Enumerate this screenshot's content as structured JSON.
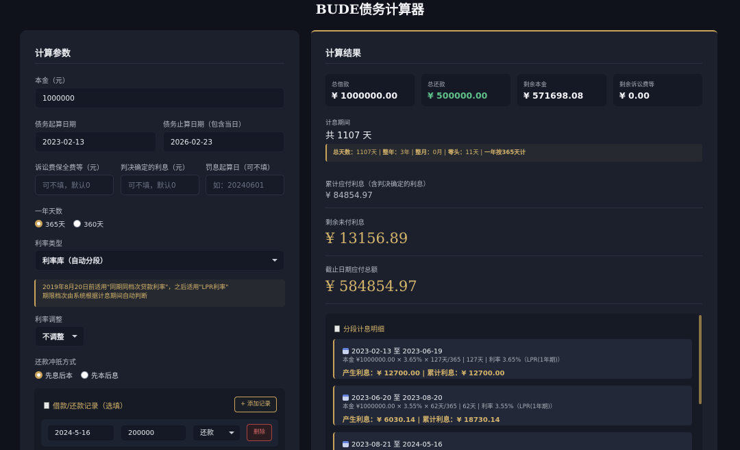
{
  "app": {
    "title": "BUDE债务计算器"
  },
  "params": {
    "title": "计算参数",
    "principal": {
      "label": "本金（元）",
      "value": "1000000"
    },
    "start_date": {
      "label": "债务起算日期",
      "value": "2023-02-13"
    },
    "end_date": {
      "label": "债务止算日期（包含当日）",
      "value": "2026-02-23"
    },
    "fees": {
      "label": "诉讼费保全费等（元）",
      "placeholder": "可不填，默认0"
    },
    "judged_interest": {
      "label": "判决确定的利息（元）",
      "placeholder": "可不填，默认0"
    },
    "penalty_date": {
      "label": "罚息起算日（可不填）",
      "placeholder": "如：20240601"
    },
    "days_per_year": {
      "label": "一年天数",
      "options": [
        "365天",
        "360天"
      ],
      "selected": "365天"
    },
    "rate_type": {
      "label": "利率类型",
      "value": "利率库（自动分段）"
    },
    "notice": {
      "line1": "2019年8月20日前适用\"同期同档次贷款利率\"，之后适用\"LPR利率\"",
      "line2": "期限档次由系统根据计息期间自动判断"
    },
    "rate_adjust": {
      "label": "利率调整",
      "value": "不调整"
    },
    "offset_method": {
      "label": "还款冲抵方式",
      "options": [
        "先息后本",
        "先本后息"
      ],
      "selected": "先息后本"
    },
    "records": {
      "title": "借款/还款记录（选填）",
      "add_label": "+ 添加记录",
      "rows": [
        {
          "date": "2024-5-16",
          "amount": "200000",
          "type": "还款",
          "delete_label": "删除"
        }
      ]
    }
  },
  "results": {
    "title": "计算结果",
    "cards": [
      {
        "label": "总借款",
        "value": "¥ 1000000.00"
      },
      {
        "label": "总还款",
        "value": "¥ 500000.00"
      },
      {
        "label": "剩余本金",
        "value": "¥ 571698.08"
      },
      {
        "label": "剩余诉讼费等",
        "value": "¥ 0.00"
      }
    ],
    "period": {
      "label": "计息期间",
      "value": "共 1107 天"
    },
    "summary": {
      "total_days_label": "总天数：",
      "total_days": "1107天",
      "years_label": "整年：",
      "years": "3年",
      "months_label": "整月：",
      "months": "0月",
      "rest_label": "零头：",
      "rest": "11天",
      "basis": "一年按365天计"
    },
    "accrued": {
      "label": "累计应付利息（含判决确定的利息）",
      "value": "¥ 84854.97"
    },
    "unpaid": {
      "label": "剩余未付利息",
      "value": "¥ 13156.89"
    },
    "total_due": {
      "label": "截止日期应付总额",
      "value": "¥ 584854.97"
    },
    "segments": {
      "title": "分段计息明细",
      "items": [
        {
          "range": "2023-02-13 至 2023-06-19",
          "formula": "本金 ¥1000000.00 × 3.65% × 127天/365 | 127天 | 利率 3.65%（LPR(1年期)）",
          "result": "产生利息：¥ 12700.00 | 累计利息：¥ 12700.00"
        },
        {
          "range": "2023-06-20 至 2023-08-20",
          "formula": "本金 ¥1000000.00 × 3.55% × 62天/365 | 62天 | 利率 3.55%（LPR(1年期)）",
          "result": "产生利息：¥ 6030.14 | 累计利息：¥ 18730.14"
        },
        {
          "range": "2023-08-21 至 2024-05-16",
          "formula": "",
          "result": ""
        }
      ]
    }
  },
  "colors": {
    "accent": "#c9a45a",
    "green": "#5fc08a",
    "danger": "#d46767"
  }
}
